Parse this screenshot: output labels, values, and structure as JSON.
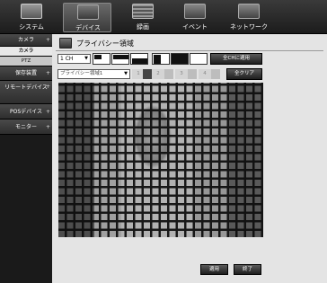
{
  "nav": {
    "tabs": [
      {
        "label": "システム",
        "icon": "monitor-icon"
      },
      {
        "label": "デバイス",
        "icon": "camera-device-icon"
      },
      {
        "label": "録画",
        "icon": "record-icon"
      },
      {
        "label": "イベント",
        "icon": "event-icon"
      },
      {
        "label": "ネットワーク",
        "icon": "network-icon"
      }
    ],
    "active_tab": "デバイス"
  },
  "sidebar": {
    "items": [
      {
        "label": "カメラ",
        "expand": "+"
      },
      {
        "label": "カメラ"
      },
      {
        "label": "PTZ"
      },
      {
        "label": "保存装置",
        "expand": "+"
      },
      {
        "label": "リモートデバイス",
        "expand": "+"
      },
      {
        "label": "POSデバイス",
        "expand": "+"
      },
      {
        "label": "モニター",
        "expand": "+"
      }
    ],
    "selected": "カメラ"
  },
  "main": {
    "title": "プライバシー領域",
    "channel": "1 CH",
    "copy_all_label": "全CHに適用",
    "zone_select": "プライバシー領域1",
    "zone_numbers": [
      "1",
      "2",
      "3",
      "4"
    ],
    "active_zone": "1",
    "clear_all_label": "全クリア",
    "apply_label": "適用",
    "close_label": "終了"
  },
  "colors": {
    "nav_bg": "#1c1c1c",
    "sidebar_bg": "#1a1a1a",
    "panel_bg": "#e4e4e4",
    "mask": "#0c0c0c"
  }
}
